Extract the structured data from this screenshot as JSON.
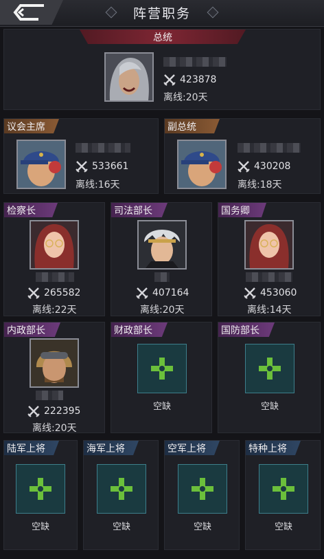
{
  "header": {
    "title": "阵营职务"
  },
  "leader": {
    "title": "总统",
    "power": "423878",
    "offline": "离线:20天"
  },
  "row2": [
    {
      "title": "议会主席",
      "power": "533661",
      "offline": "离线:16天"
    },
    {
      "title": "副总统",
      "power": "430208",
      "offline": "离线:18天"
    }
  ],
  "row3": [
    {
      "title": "检察长",
      "power": "265582",
      "offline": "离线:22天"
    },
    {
      "title": "司法部长",
      "power": "407164",
      "offline": "离线:20天"
    },
    {
      "title": "国务卿",
      "power": "453060",
      "offline": "离线:14天"
    }
  ],
  "row4": [
    {
      "title": "内政部长",
      "power": "222395",
      "offline": "离线:20天"
    },
    {
      "title": "财政部长",
      "status": "空缺"
    },
    {
      "title": "国防部长",
      "status": "空缺"
    }
  ],
  "row5": [
    {
      "title": "陆军上将",
      "status": "空缺"
    },
    {
      "title": "海军上将",
      "status": "空缺"
    },
    {
      "title": "空军上将",
      "status": "空缺"
    },
    {
      "title": "特种上将",
      "status": "空缺"
    }
  ],
  "colors": {
    "brown_banner": "#8a5a34",
    "purple_banner": "#6c3a7a",
    "blue_banner": "#2f4663",
    "red_banner": "#7e2633",
    "vacant_accent": "#6bbf3b"
  }
}
